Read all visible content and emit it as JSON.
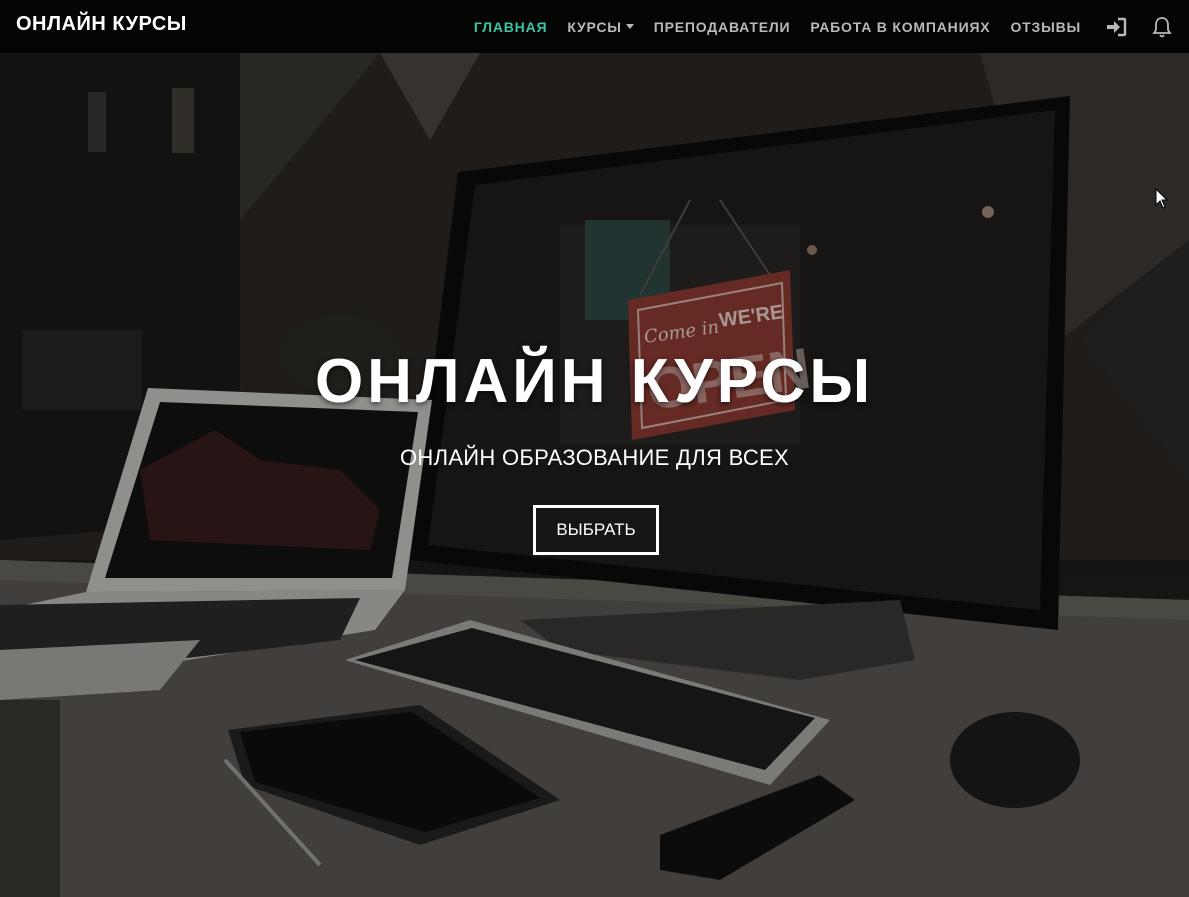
{
  "navbar": {
    "brand": "ОНЛАЙН КУРСЫ",
    "items": [
      {
        "label": "ГЛАВНАЯ",
        "active": true
      },
      {
        "label": "КУРСЫ",
        "dropdown": true
      },
      {
        "label": "ПРЕПОДАВАТЕЛИ"
      },
      {
        "label": "РАБОТА В КОМПАНИЯХ"
      },
      {
        "label": "ОТЗЫВЫ"
      }
    ],
    "icons": [
      "sign-in-icon",
      "bell-icon"
    ],
    "active_color": "#3cc4a8"
  },
  "hero": {
    "title": "ОНЛАЙН КУРСЫ",
    "subtitle": "ОНЛАЙН ОБРАЗОВАНИЕ ДЛЯ ВСЕХ",
    "button_label": "ВЫБРАТЬ",
    "sign_text_top": "Come in",
    "sign_text_bold": "WE'RE",
    "sign_text_big": "OPEN"
  }
}
